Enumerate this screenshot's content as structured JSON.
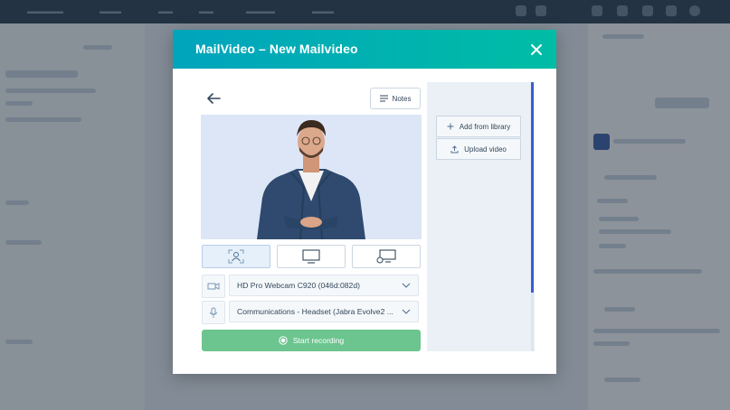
{
  "modal": {
    "title": "MailVideo – New Mailvideo",
    "notes_label": "Notes",
    "camera_device": "HD Pro Webcam C920 (046d:082d)",
    "mic_device": "Communications - Headset (Jabra Evolve2 ...",
    "record_label": "Start recording",
    "side": {
      "add_library_label": "Add from library",
      "upload_label": "Upload video"
    },
    "colors": {
      "header_start": "#00a4bd",
      "header_end": "#00bda5",
      "record": "#6cc58f",
      "scrollbar": "#3d5bd6"
    },
    "icons": [
      "close-icon",
      "back-arrow-icon",
      "notes-icon",
      "camera-only-icon",
      "screen-icon",
      "screen-camera-icon",
      "webcam-icon",
      "microphone-icon",
      "chevron-down-icon",
      "record-icon",
      "plus-icon",
      "upload-icon"
    ]
  }
}
